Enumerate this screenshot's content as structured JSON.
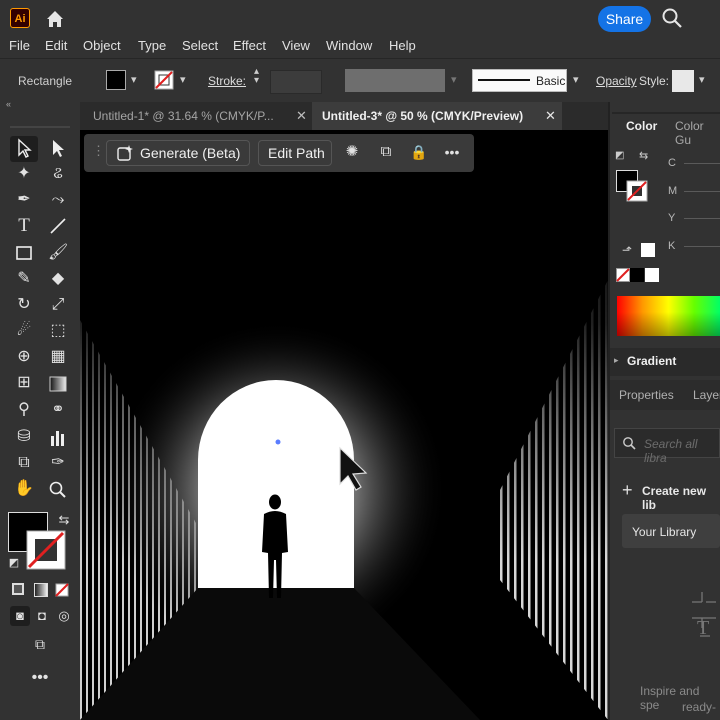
{
  "app": {
    "logo_text": "Ai",
    "share_label": "Share"
  },
  "menu": [
    "File",
    "Edit",
    "Object",
    "Type",
    "Select",
    "Effect",
    "View",
    "Window",
    "Help"
  ],
  "control_bar": {
    "selection_type": "Rectangle",
    "fill_color": "#000000",
    "stroke_label": "Stroke:",
    "profile_label": "Basic",
    "opacity_label": "Opacity",
    "style_label": "Style:"
  },
  "tabs": [
    {
      "label": "Untitled-1* @ 31.64 % (CMYK/P...",
      "active": false
    },
    {
      "label": "Untitled-3* @ 50 % (CMYK/Preview)",
      "active": true
    }
  ],
  "context_bar": {
    "generate_label": "Generate (Beta)",
    "edit_path_label": "Edit Path"
  },
  "panels": {
    "color_tab": "Color",
    "color_guide_tab": "Color Gu",
    "cmyk_labels": [
      "C",
      "M",
      "Y",
      "K"
    ],
    "gradient_tab": "Gradient",
    "properties_tab": "Properties",
    "layers_tab": "Layer",
    "library_search_placeholder": "Search all libra",
    "create_library_label": "Create new lib",
    "your_library_label": "Your Library",
    "empty_text_1": "Inspire and spe",
    "empty_text_2": "ready-"
  },
  "colors": {
    "accent": "#1473e6",
    "panel": "#323232",
    "canvas_bg": "#000000"
  }
}
